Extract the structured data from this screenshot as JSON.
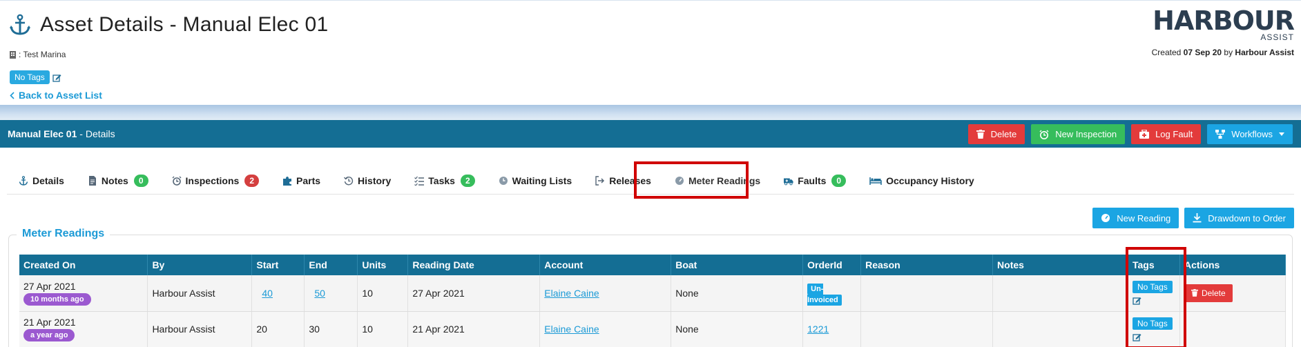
{
  "header": {
    "title": "Asset Details - Manual Elec 01",
    "marina": ": Test Marina",
    "tag": "No Tags",
    "back_link": "Back to Asset List",
    "logo_main": "HARBOUR",
    "logo_sub": "ASSIST",
    "created_prefix": "Created",
    "created_date": "07 Sep 20",
    "created_by_prefix": "by",
    "created_by": "Harbour Assist"
  },
  "panel": {
    "title_bold": "Manual Elec 01",
    "title_rest": " - Details",
    "actions": {
      "delete": "Delete",
      "new_inspection": "New Inspection",
      "log_fault": "Log Fault",
      "workflows": "Workflows"
    }
  },
  "tabs": {
    "details": "Details",
    "notes": "Notes",
    "notes_count": "0",
    "inspections": "Inspections",
    "inspections_count": "2",
    "parts": "Parts",
    "history": "History",
    "tasks": "Tasks",
    "tasks_count": "2",
    "waiting_lists": "Waiting Lists",
    "releases": "Releases",
    "meter_readings": "Meter Readings",
    "faults": "Faults",
    "faults_count": "0",
    "occupancy_history": "Occupancy History"
  },
  "section": {
    "legend": "Meter Readings",
    "new_reading": "New Reading",
    "drawdown": "Drawdown to Order"
  },
  "table": {
    "headers": [
      "Created On",
      "By",
      "Start",
      "End",
      "Units",
      "Reading Date",
      "Account",
      "Boat",
      "OrderId",
      "Reason",
      "Notes",
      "Tags",
      "Actions"
    ],
    "rows": [
      {
        "created_on": "27 Apr 2021",
        "age": "10 months ago",
        "by": "Harbour Assist",
        "start": "40",
        "end": "50",
        "units": "10",
        "reading_date": "27 Apr 2021",
        "account": "Elaine Caine",
        "boat": "None",
        "order": "Un-Invoiced",
        "reason": "",
        "notes": "",
        "tag": "No Tags",
        "action": "Delete"
      },
      {
        "created_on": "21 Apr 2021",
        "age": "a year ago",
        "by": "Harbour Assist",
        "start": "20",
        "end": "30",
        "units": "10",
        "reading_date": "21 Apr 2021",
        "account": "Elaine Caine",
        "boat": "None",
        "order": "1221",
        "reason": "",
        "notes": "",
        "tag": "No Tags",
        "action": ""
      }
    ]
  },
  "colors": {
    "primary": "#146e94",
    "accent": "#1ba5e3",
    "danger": "#e33b3b",
    "success": "#36bd5c",
    "highlight": "#d00000"
  }
}
